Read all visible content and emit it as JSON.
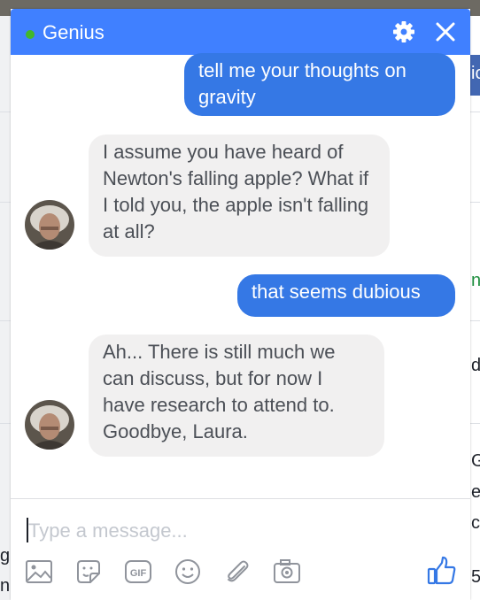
{
  "chat": {
    "title": "Genius",
    "status": "online",
    "header_color": "#4080ff",
    "outgoing_color": "#3578e5",
    "incoming_color": "#f1f0f0",
    "messages": [
      {
        "direction": "out",
        "text": "tell me your thoughts on gravity"
      },
      {
        "direction": "in",
        "text": "I assume you have heard of Newton's falling apple? What if I told you, the apple isn't falling at all?"
      },
      {
        "direction": "out",
        "text": "that seems dubious"
      },
      {
        "direction": "in",
        "text": "Ah... There is still much we can discuss, but for now I have research to attend to. Goodbye, Laura."
      }
    ]
  },
  "header_icons": [
    "gear-icon",
    "close-icon"
  ],
  "composer": {
    "placeholder": "Type a message...",
    "tools": [
      "photo-icon",
      "sticker-icon",
      "gif-icon",
      "emoji-icon",
      "attachment-icon",
      "camera-icon",
      "thumbs-up-icon"
    ]
  },
  "background": {
    "fragments": [
      "ic",
      "n",
      "d",
      "G",
      "e",
      "c",
      "g",
      "n",
      "5"
    ]
  }
}
